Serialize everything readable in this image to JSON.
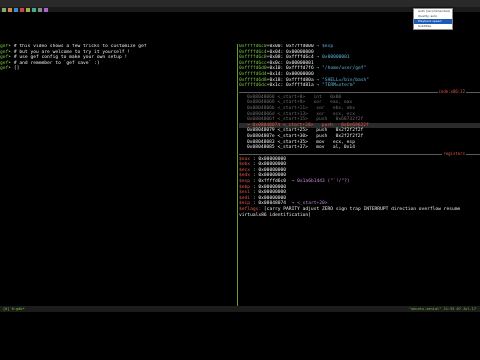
{
  "left": {
    "lines": [
      {
        "p": "gef➤ ",
        "t": "# this video shows a few tricks to customize gef"
      },
      {
        "p": "gef➤ ",
        "t": "# but you are welcome to try it yourself !"
      },
      {
        "p": "gef➤ ",
        "t": "# use gef config to make your own setup !"
      },
      {
        "p": "gef➤ ",
        "t": "# and remember to `gef save` :)"
      },
      {
        "p": "gef➤ ",
        "t": "[]"
      }
    ]
  },
  "right": {
    "stack": [
      {
        "a": "0xffffd6c0",
        "o": "+0x00: ",
        "v": "0xf7ffd000",
        "x": "→ $esp"
      },
      {
        "a": "0xffffd6c4",
        "o": "+0x04: ",
        "v": "0x00000000",
        "x": ""
      },
      {
        "a": "0xffffd6c8",
        "o": "+0x08: ",
        "v": "0xffffd6c4",
        "x": "→ 0x00000001"
      },
      {
        "a": "0xffffd6cc",
        "o": "+0x0c: ",
        "v": "0x00000001",
        "x": ""
      },
      {
        "a": "0xffffd6d0",
        "o": "+0x10: ",
        "v": "0xffffd7f6",
        "x": "→ \"/home/user/gef\""
      },
      {
        "a": "0xffffd6d4",
        "o": "+0x14: ",
        "v": "0x00000000",
        "x": ""
      },
      {
        "a": "0xffffd6d8",
        "o": "+0x18: ",
        "v": "0xffffd80a",
        "x": "→ \"SHELL=/bin/bash\""
      },
      {
        "a": "0xffffd6dc",
        "o": "+0x1c: ",
        "v": "0xffffd81a",
        "x": "→ \"TERM=xterm\""
      }
    ],
    "sep_code": "code:x86:32",
    "code": [
      {
        "a": "0x08048068",
        "f": "<_start+8>",
        "op": "int",
        "args": "0x80",
        "cur": false,
        "dim": true
      },
      {
        "a": "0x08048069",
        "f": "<_start+9>",
        "op": "xor",
        "args": "eax, eax",
        "cur": false,
        "dim": true
      },
      {
        "a": "0x0804806b",
        "f": "<_start+11>",
        "op": "xor",
        "args": "ebx, ebx",
        "cur": false,
        "dim": true
      },
      {
        "a": "0x0804806d",
        "f": "<_start+13>",
        "op": "xor",
        "args": "ecx, ecx",
        "cur": false,
        "dim": true
      },
      {
        "a": "0x0804806f",
        "f": "<_start+15>",
        "op": "push",
        "args": "0x68732f2f",
        "cur": false,
        "dim": true
      },
      {
        "a": "→ 0x08048074",
        "f": "<_start+20>",
        "op": "push",
        "args": "0x6e69622f",
        "cur": true,
        "dim": false
      },
      {
        "a": "0x08048079",
        "f": "<_start+25>",
        "op": "push",
        "args": "0x2f2f2f2f",
        "cur": false,
        "dim": false
      },
      {
        "a": "0x0804807e",
        "f": "<_start+30>",
        "op": "push",
        "args": "0x2f2f2f2f",
        "cur": false,
        "dim": false
      },
      {
        "a": "0x08048083",
        "f": "<_start+35>",
        "op": "mov",
        "args": "ecx, esp",
        "cur": false,
        "dim": false
      },
      {
        "a": "0x08048085",
        "f": "<_start+37>",
        "op": "mov",
        "args": "al, 0x14",
        "cur": false,
        "dim": false
      }
    ],
    "sep_regs": "registers",
    "regs": [
      {
        "n": "$eax ",
        "v": ": 0x00000000",
        "x": ""
      },
      {
        "n": "$ebx ",
        "v": ": 0x00000000",
        "x": ""
      },
      {
        "n": "$ecx ",
        "v": ": 0x00000000",
        "x": ""
      },
      {
        "n": "$edx ",
        "v": ": 0x00000000",
        "x": ""
      },
      {
        "n": "$esp ",
        "v": ": 0xffffd6c0",
        "x": "→ 0x1a6b1443 (\"`!/\"?)"
      },
      {
        "n": "$ebp ",
        "v": ": 0x00000000",
        "x": ""
      },
      {
        "n": "$esi ",
        "v": ": 0x00000000",
        "x": ""
      },
      {
        "n": "$edi ",
        "v": ": 0x00000000",
        "x": ""
      },
      {
        "n": "$eip ",
        "v": ": 0x08048074",
        "x": "→ <_start+20>"
      }
    ],
    "flags_label": "$eflags: ",
    "flags": "[carry PARITY adjust ZERO sign trap INTERRUPT direction overflow resume virtualx86 identification]"
  },
  "menu": {
    "items": [
      {
        "label": "Auto (recommended)",
        "selected": false
      },
      {
        "label": "Quality: auto",
        "selected": false
      },
      {
        "label": "Playback speed",
        "selected": true
      },
      {
        "label": "Subtitles",
        "selected": false
      }
    ]
  },
  "status": {
    "left": "[0] 0:gdb*",
    "right": "\"ubuntu-xenial\" 21:35 07-Jul-17"
  }
}
